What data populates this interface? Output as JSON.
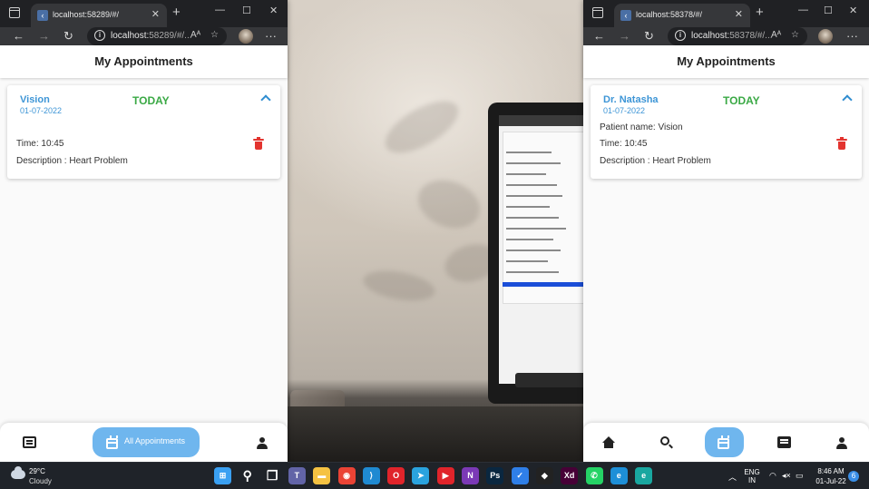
{
  "left_browser": {
    "tab_title": "localhost:58289/#/",
    "url_main": "localhost:",
    "url_rest": "58289/#/...",
    "app": {
      "header_title": "My Appointments",
      "card": {
        "name": "Vision",
        "date": "01-07-2022",
        "today": "TODAY",
        "time": "Time: 10:45",
        "description": "Description : Heart Problem"
      },
      "nav": {
        "pill_label": "All Appointments"
      }
    }
  },
  "right_browser": {
    "tab_title": "localhost:58378/#/",
    "url_main": "localhost:",
    "url_rest": "58378/#/...",
    "app": {
      "header_title": "My Appointments",
      "card": {
        "name": "Dr. Natasha",
        "date": "01-07-2022",
        "today": "TODAY",
        "patient": "Patient name: Vision",
        "time": "Time: 10:45",
        "description": "Description : Heart Problem"
      }
    }
  },
  "taskbar": {
    "weather_temp": "29°C",
    "weather_desc": "Cloudy",
    "lang_top": "ENG",
    "lang_bottom": "IN",
    "time": "8:46 AM",
    "date": "01-Jul-22",
    "notification_count": "6",
    "apps": [
      {
        "name": "Windows Start",
        "icon": "windows-logo-icon",
        "color": "#3aa0f2"
      },
      {
        "name": "Search",
        "icon": "search-icon",
        "color": "transparent"
      },
      {
        "name": "Task View",
        "icon": "task-view-icon",
        "color": "transparent"
      },
      {
        "name": "Teams",
        "icon": "teams-icon",
        "color": "#6264a7"
      },
      {
        "name": "File Explorer",
        "icon": "folder-icon",
        "color": "#f5c242"
      },
      {
        "name": "Chrome",
        "icon": "chrome-icon",
        "color": "#ea4335"
      },
      {
        "name": "VS Code",
        "icon": "vscode-icon",
        "color": "#1f8ad2"
      },
      {
        "name": "Opera",
        "icon": "opera-icon",
        "color": "#e0242b"
      },
      {
        "name": "Telegram",
        "icon": "telegram-icon",
        "color": "#2aa3df"
      },
      {
        "name": "YouTube Music",
        "icon": "youtube-icon",
        "color": "#e0242b"
      },
      {
        "name": "OneNote",
        "icon": "onenote-icon",
        "color": "#7b39b6"
      },
      {
        "name": "Photoshop",
        "icon": "photoshop-icon",
        "color": "#0a2740"
      },
      {
        "name": "To Do",
        "icon": "todo-icon",
        "color": "#2f7fe8"
      },
      {
        "name": "Figma",
        "icon": "figma-icon",
        "color": "#222222"
      },
      {
        "name": "Adobe XD",
        "icon": "xd-icon",
        "color": "#470137"
      },
      {
        "name": "WhatsApp",
        "icon": "whatsapp-icon",
        "color": "#25d366"
      },
      {
        "name": "Edge",
        "icon": "edge-icon",
        "color": "#1d8fd8"
      },
      {
        "name": "Edge Dev",
        "icon": "edge-dev-icon",
        "color": "#19a7a0"
      }
    ]
  },
  "colors": {
    "accent_blue": "#3d95d6",
    "today_green": "#3aa945",
    "delete_red": "#e3342f",
    "pill_blue": "#6fb6ee"
  }
}
